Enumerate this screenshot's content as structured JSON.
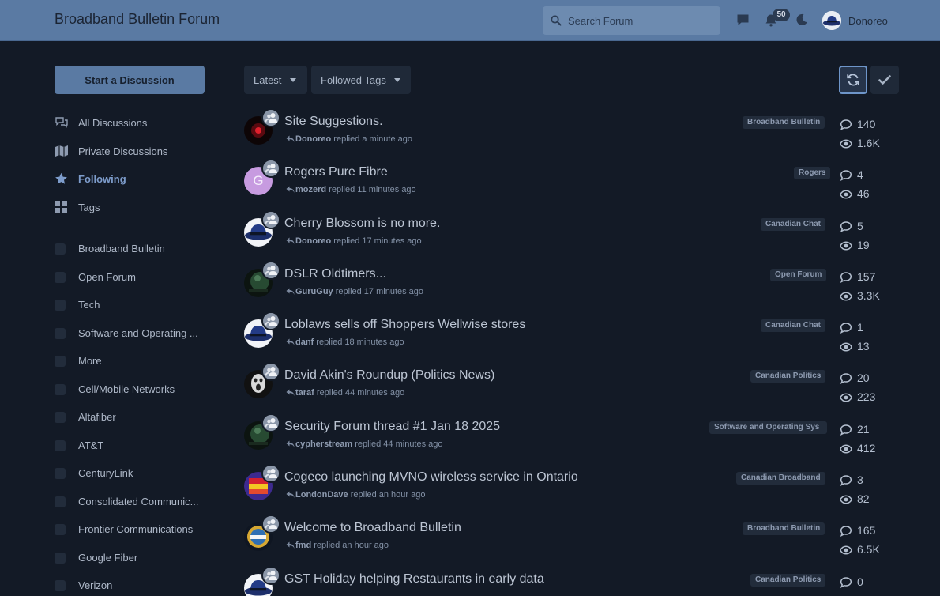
{
  "header": {
    "site_title": "Broadband Bulletin Forum",
    "search_placeholder": "Search Forum",
    "notification_count": "50",
    "username": "Donoreo"
  },
  "sidebar": {
    "start_button": "Start a Discussion",
    "nav": [
      {
        "label": "All Discussions",
        "icon": "discussions-icon"
      },
      {
        "label": "Private Discussions",
        "icon": "map-icon"
      },
      {
        "label": "Following",
        "icon": "star-icon",
        "active": true
      },
      {
        "label": "Tags",
        "icon": "tags-grid-icon"
      }
    ],
    "tags": [
      "Broadband Bulletin",
      "Open Forum",
      "Tech",
      "Software and Operating ...",
      "More",
      "Cell/Mobile Networks",
      "Altafiber",
      "AT&T",
      "CenturyLink",
      "Consolidated Communic...",
      "Frontier Communications",
      "Google Fiber",
      "Verizon"
    ]
  },
  "toolbar": {
    "sort_label": "Latest",
    "filter_label": "Followed Tags",
    "refresh_icon": "refresh-icon",
    "mark_read_icon": "check-icon"
  },
  "discussions": [
    {
      "title": "Site Suggestions.",
      "user": "Donoreo",
      "action": "replied a minute ago",
      "tag": "Broadband Bulletin",
      "replies": "140",
      "views": "1.6K",
      "avatar": "red-dark"
    },
    {
      "title": "Rogers Pure Fibre",
      "user": "mozerd",
      "action": "replied 11 minutes ago",
      "tag": "Rogers",
      "replies": "4",
      "views": "46",
      "avatar": "letter",
      "avatar_letter": "G"
    },
    {
      "title": "Cherry Blossom is no more.",
      "user": "Donoreo",
      "action": "replied 17 minutes ago",
      "tag": "Canadian Chat",
      "replies": "5",
      "views": "19",
      "avatar": "hat"
    },
    {
      "title": "DSLR Oldtimers...",
      "user": "GuruGuy",
      "action": "replied 17 minutes ago",
      "tag": "Open Forum",
      "replies": "157",
      "views": "3.3K",
      "avatar": "green"
    },
    {
      "title": "Loblaws sells off Shoppers Wellwise stores",
      "user": "danf",
      "action": "replied 18 minutes ago",
      "tag": "Canadian Chat",
      "replies": "1",
      "views": "13",
      "avatar": "hat"
    },
    {
      "title": "David Akin's Roundup (Politics News)",
      "user": "taraf",
      "action": "replied 44 minutes ago",
      "tag": "Canadian Politics",
      "replies": "20",
      "views": "223",
      "avatar": "scream"
    },
    {
      "title": "Security Forum thread #1 Jan 18 2025",
      "user": "cypherstream",
      "action": "replied 44 minutes ago",
      "tag": "Software and Operating Sys",
      "replies": "21",
      "views": "412",
      "avatar": "green"
    },
    {
      "title": "Cogeco launching MVNO wireless service in Ontario",
      "user": "LondonDave",
      "action": "replied an hour ago",
      "tag": "Canadian Broadband",
      "replies": "3",
      "views": "82",
      "avatar": "flag"
    },
    {
      "title": "Welcome to Broadband Bulletin",
      "user": "fmd",
      "action": "replied an hour ago",
      "tag": "Broadband Bulletin",
      "replies": "165",
      "views": "6.5K",
      "avatar": "badge"
    },
    {
      "title": "GST Holiday helping Restaurants in early data",
      "user": "",
      "action": "",
      "tag": "Canadian Politics",
      "replies": "0",
      "views": "",
      "avatar": "hat"
    }
  ]
}
